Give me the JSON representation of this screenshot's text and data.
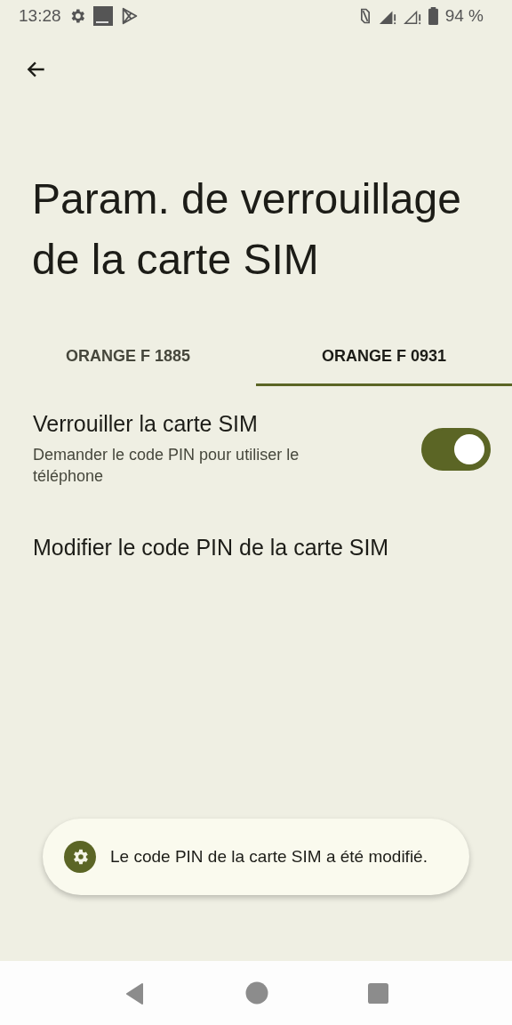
{
  "status_bar": {
    "time": "13:28",
    "battery": "94 %"
  },
  "title": "Param. de verrouillage de la carte SIM",
  "tabs": [
    {
      "label": "ORANGE F 1885",
      "selected": false
    },
    {
      "label": "ORANGE F 0931",
      "selected": true
    }
  ],
  "settings": [
    {
      "kind": "switch",
      "title": "Verrouiller la carte SIM",
      "summary": "Demander le code PIN pour utiliser le téléphone",
      "on": true
    },
    {
      "kind": "action",
      "title": "Modifier le code PIN de la carte SIM"
    }
  ],
  "toast": {
    "message": "Le code PIN de la carte SIM a été modifié."
  }
}
